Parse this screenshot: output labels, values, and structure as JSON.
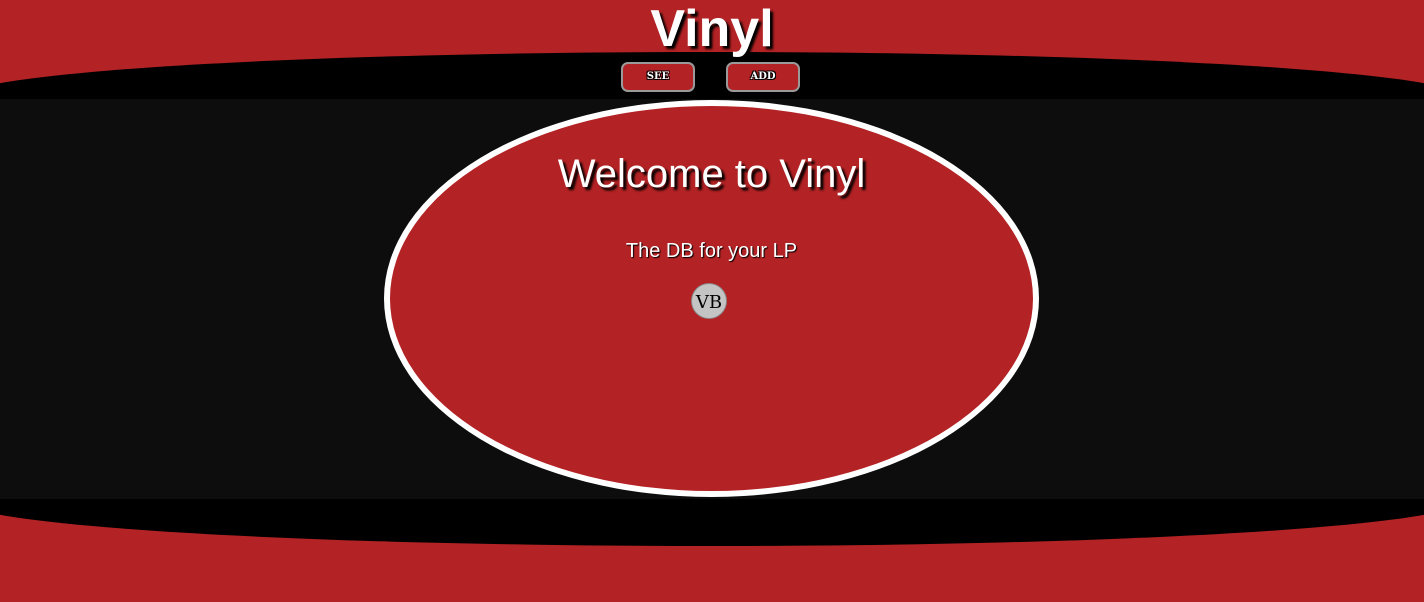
{
  "header": {
    "title": "Vinyl"
  },
  "nav": {
    "see_label": "SEE",
    "add_label": "ADD"
  },
  "main": {
    "heading": "Welcome to Vinyl",
    "tagline": "The DB for your LP",
    "logo_text": "VB"
  },
  "colors": {
    "brand_red": "#b32224",
    "band_black": "#000000",
    "panel_dark": "#0d0d0d",
    "record_border": "#ffffff",
    "logo_bg": "#c4c4c4"
  }
}
